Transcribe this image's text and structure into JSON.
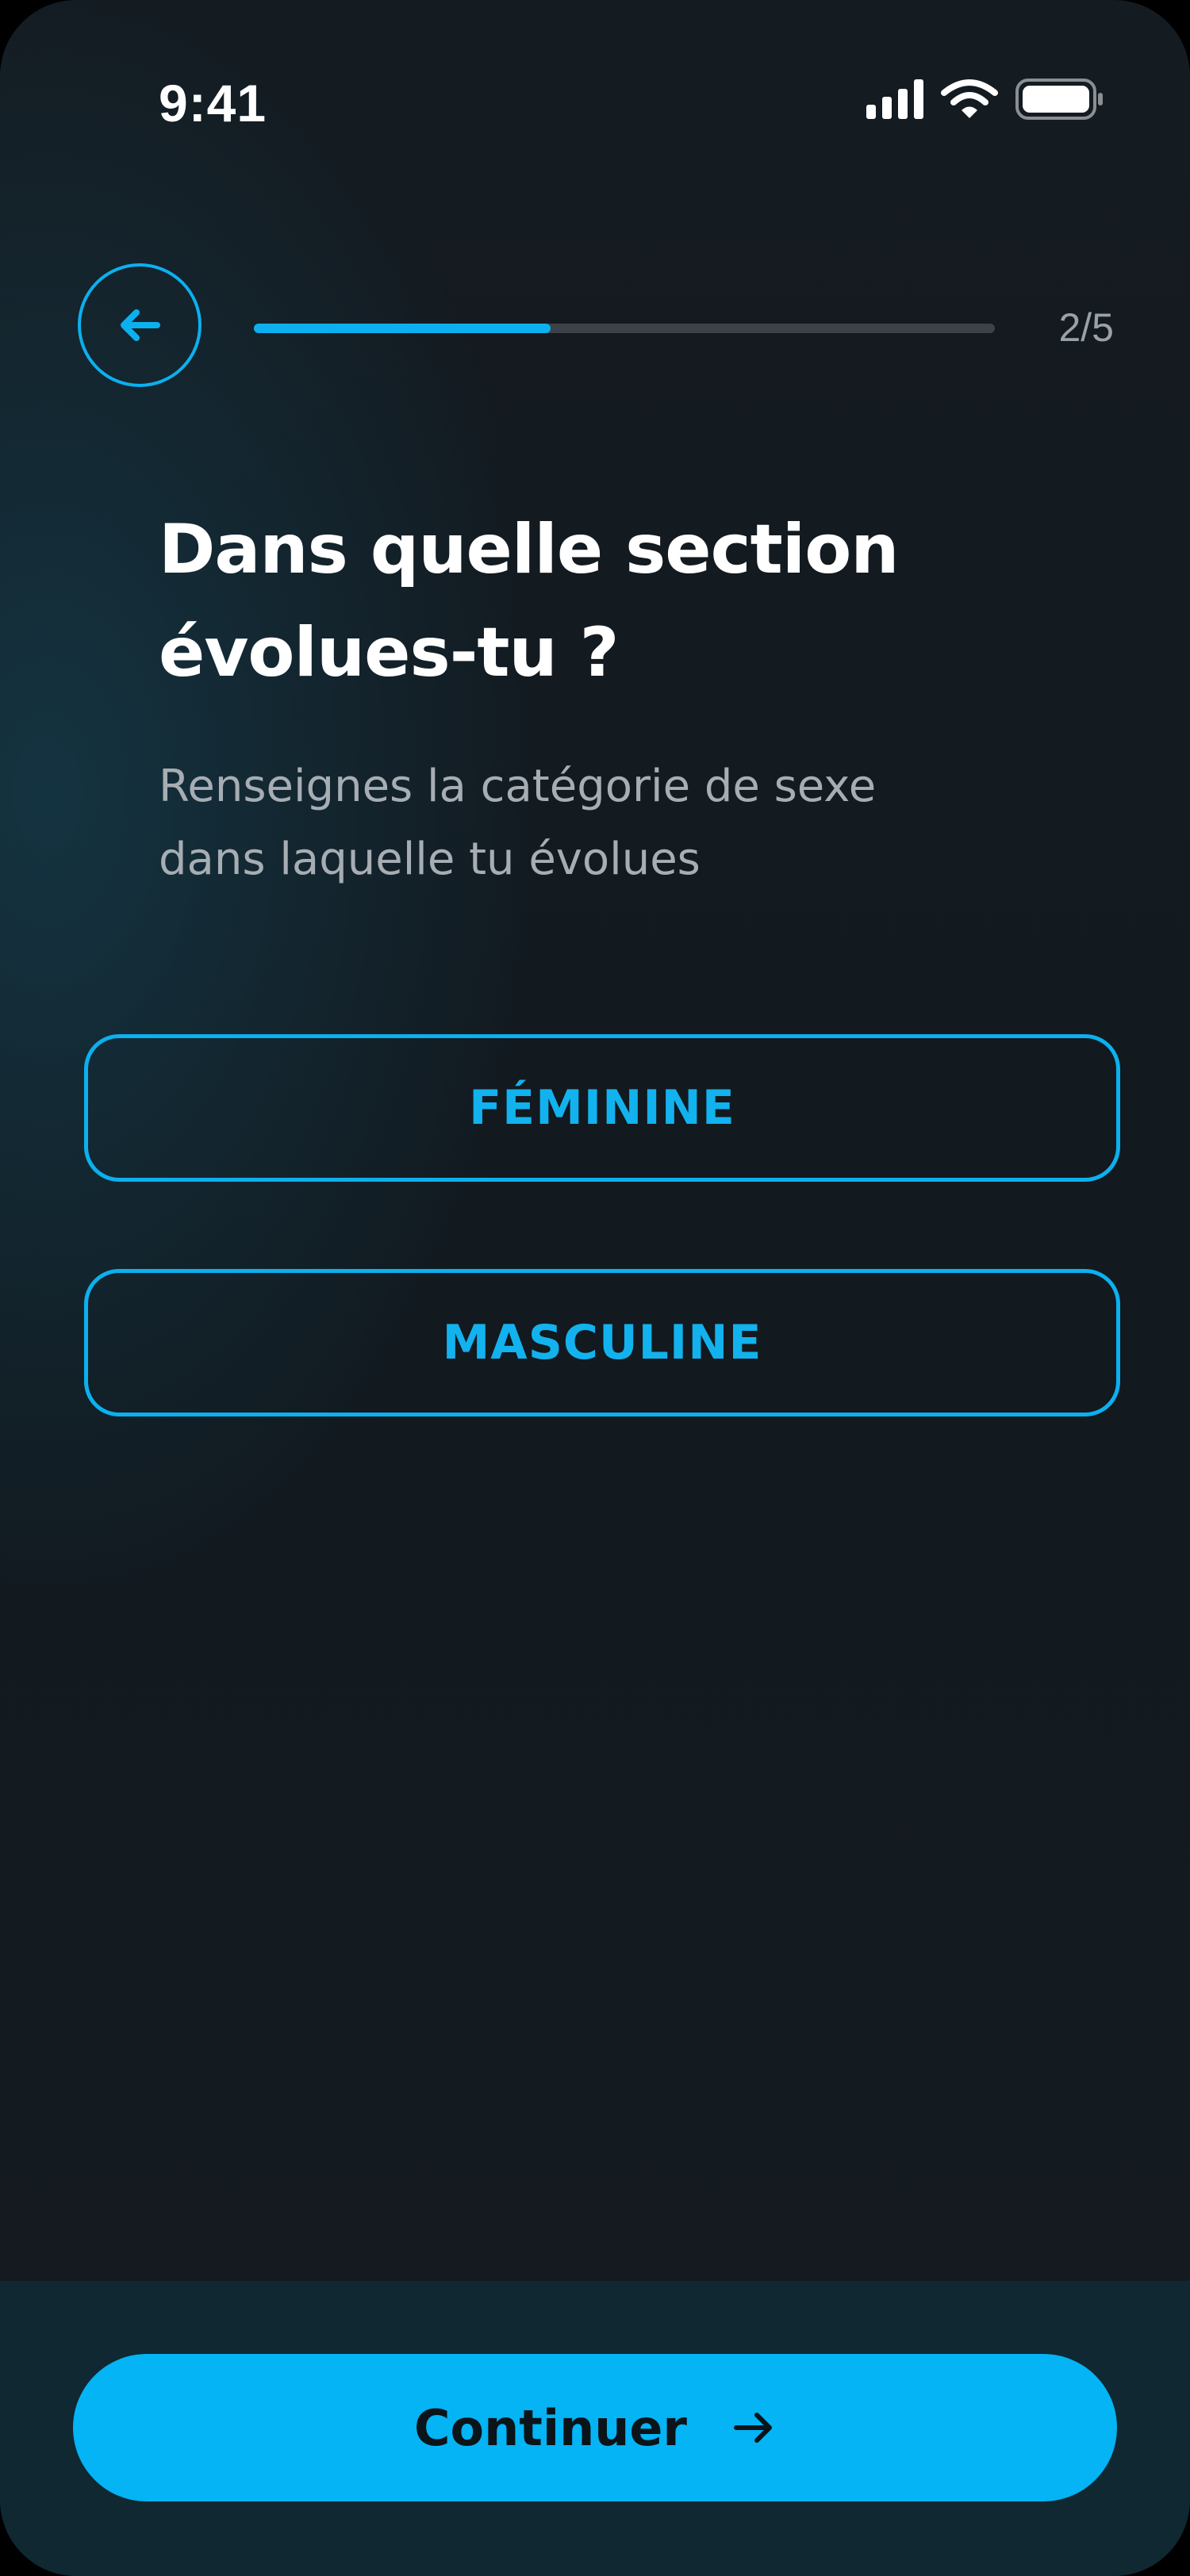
{
  "status_bar": {
    "time": "9:41",
    "icons": [
      "cellular-signal-icon",
      "wifi-icon",
      "battery-icon"
    ]
  },
  "header": {
    "back_icon": "arrow-left-icon",
    "progress_fraction": 0.4,
    "step_label": "2/5"
  },
  "content": {
    "title_line1": "Dans quelle section",
    "title_line2": "évolues-tu ?",
    "subtitle_line1": "Renseignes la catégorie de sexe",
    "subtitle_line2": "dans laquelle tu évolues"
  },
  "options": [
    {
      "label": "FÉMININE"
    },
    {
      "label": "MASCULINE"
    }
  ],
  "footer": {
    "continue_label": "Continuer",
    "continue_icon": "arrow-right-icon"
  },
  "colors": {
    "accent": "#0cb0ee",
    "button_fill": "#04b4f4",
    "background": "#141b21",
    "footer_background": "#0f2831"
  }
}
